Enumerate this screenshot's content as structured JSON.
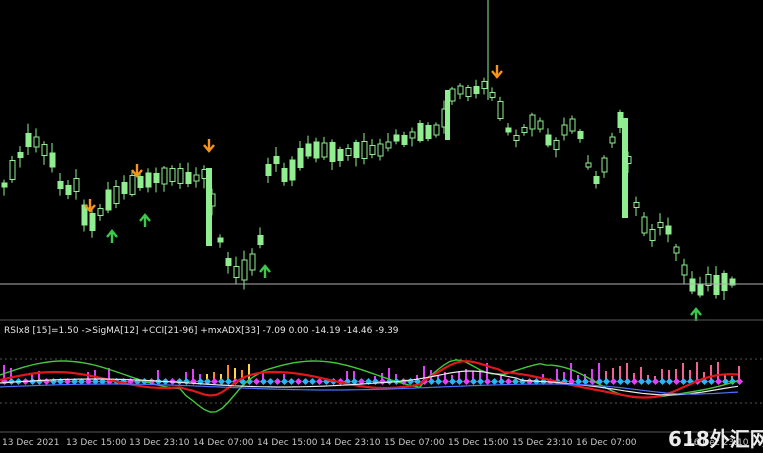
{
  "chart": {
    "background": "#000000",
    "candle_color": "#90ee90",
    "wick_color": "#90ee90",
    "sell_arrow_color": "#f7941d",
    "buy_arrow_color": "#3cc84a",
    "h_line_color": "#b0b0b0"
  },
  "indicator": {
    "label": "RSIx8 [15]=1.50 ->SigMA[12] +CCI[21-96] +mxADX[33] -7.09 0.00 -14.19 -14.46 -9.39",
    "line_colors": {
      "green": "#43c83c",
      "red": "#e0181c",
      "white": "#e8e8e8",
      "blue": "#4a73ff"
    },
    "dot_colors": [
      "#e040fb",
      "#29b6f6"
    ],
    "bar_colors": [
      "#ff8a1c",
      "#ffd740",
      "#e040fb",
      "#f06292"
    ]
  },
  "time_axis": {
    "labels": [
      "13 Dec 2021",
      "13 Dec 15:00",
      "13 Dec 23:10",
      "14 Dec 07:00",
      "14 Dec 15:00",
      "14 Dec 23:10",
      "15 Dec 07:00",
      "15 Dec 15:00",
      "15 Dec 23:10",
      "16 Dec 07:00",
      "16 Dec 23:10"
    ]
  },
  "watermark": "618外汇网"
}
